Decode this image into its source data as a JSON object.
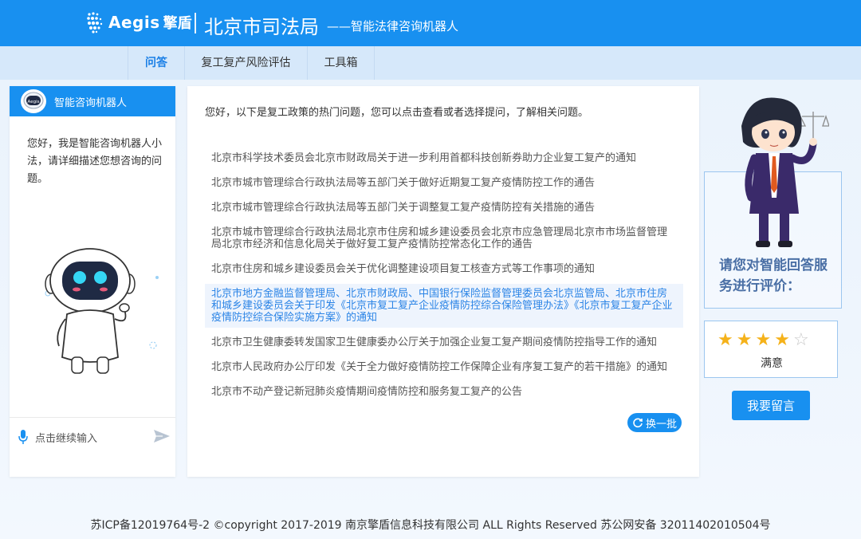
{
  "header": {
    "logo_text": "Aegis",
    "logo_cn": "擎盾",
    "title": "北京市司法局",
    "subtitle": "——智能法律咨询机器人"
  },
  "nav": {
    "items": [
      {
        "label": "问答"
      },
      {
        "label": "复工复产风险评估"
      },
      {
        "label": "工具箱"
      }
    ]
  },
  "left": {
    "avatar_text": "Aegis",
    "title": "智能咨询机器人",
    "greeting": "您好，我是智能咨询机器人小法，请详细描述您想咨询的问题。",
    "input_placeholder": "点击继续输入"
  },
  "center": {
    "intro": "您好，以下是复工政策的热门问题，您可以点击查看或者选择提问，了解相关问题。",
    "questions": [
      "北京市科学技术委员会北京市财政局关于进一步利用首都科技创新券助力企业复工复产的通知",
      "北京市城市管理综合行政执法局等五部门关于做好近期复工复产疫情防控工作的通告",
      "北京市城市管理综合行政执法局等五部门关于调整复工复产疫情防控有关措施的通告",
      "北京市城市管理综合行政执法局北京市住房和城乡建设委员会北京市应急管理局北京市市场监督管理局北京市经济和信息化局关于做好复工复产疫情防控常态化工作的通告",
      "北京市住房和城乡建设委员会关于优化调整建设项目复工核查方式等工作事项的通知",
      "北京市地方金融监督管理局、北京市财政局、中国银行保险监督管理委员会北京监管局、北京市住房和城乡建设委员会关于印发《北京市复工复产企业疫情防控综合保险管理办法》《北京市复工复产企业疫情防控综合保险实施方案》的通知",
      "北京市卫生健康委转发国家卫生健康委办公厅关于加强企业复工复产期间疫情防控指导工作的通知",
      "北京市人民政府办公厅印发《关于全力做好疫情防控工作保障企业有序复工复产的若干措施》的通知",
      "北京市不动产登记新冠肺炎疫情期间疫情防控和服务复工复产的公告"
    ],
    "refresh_label": "换一批"
  },
  "right": {
    "rate_prompt": "请您对智能回答服务进行评价：",
    "rating": 4,
    "rating_max": 5,
    "rating_label": "满意",
    "message_button": "我要留言"
  },
  "footer": {
    "text": "苏ICP备12019764号-2 ©copyright 2017-2019 南京擎盾信息科技有限公司 ALL Rights Reserved 苏公网安备 32011402010504号"
  },
  "colors": {
    "primary": "#1890f0",
    "nav_bg": "#d6e8fa",
    "star": "#f5b21a",
    "highlight_text": "#2b84e6"
  }
}
